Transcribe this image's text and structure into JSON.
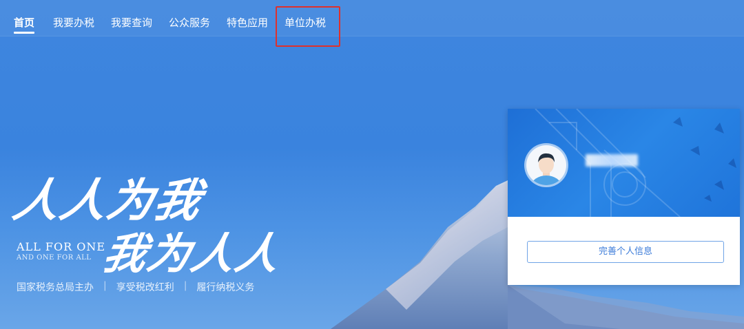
{
  "nav": {
    "items": [
      {
        "label": "首页"
      },
      {
        "label": "我要办税"
      },
      {
        "label": "我要查询"
      },
      {
        "label": "公众服务"
      },
      {
        "label": "特色应用"
      },
      {
        "label": "单位办税"
      }
    ],
    "active_index": 0,
    "highlighted_index": 5
  },
  "banner": {
    "slogan_line1": "人人为我",
    "slogan_line2": "我为人人",
    "english_line1": "ALL FOR ONE",
    "english_line2": "AND ONE FOR ALL",
    "tagline": [
      "国家税务总局主办",
      "享受税改红利",
      "履行纳税义务"
    ]
  },
  "user_card": {
    "complete_info_button": "完善个人信息"
  },
  "colors": {
    "nav_text": "#ffffff",
    "highlight_border": "#e0302a",
    "button_text": "#3a7ad8",
    "card_header": "#1e6fd6"
  }
}
